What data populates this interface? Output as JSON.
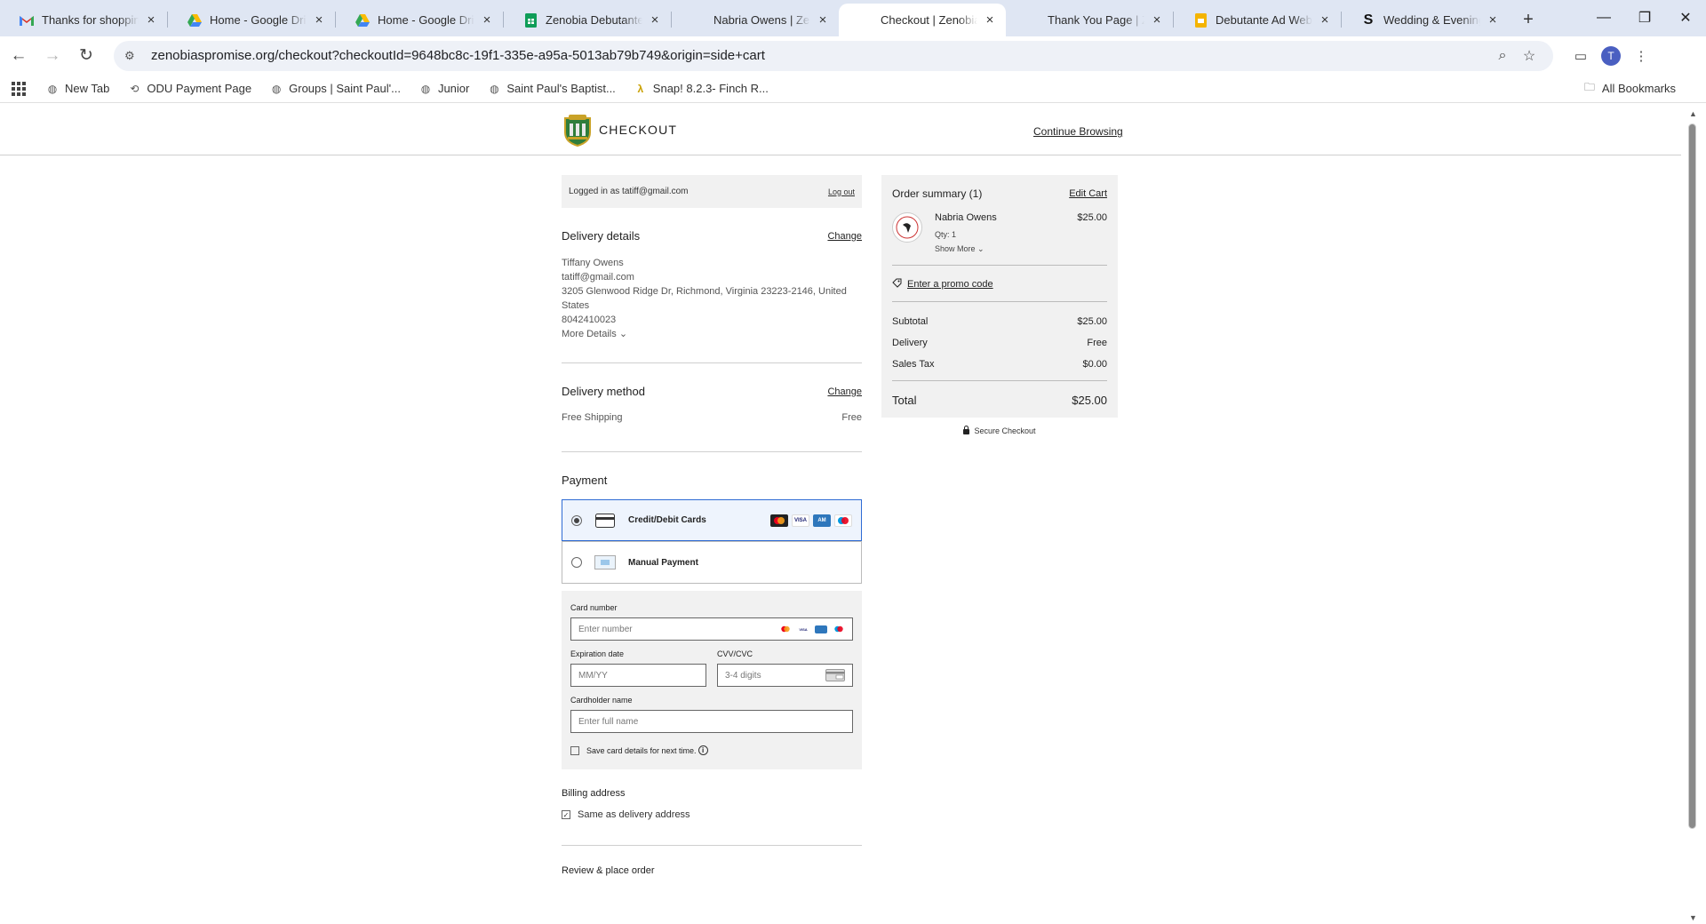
{
  "browser": {
    "tabs": [
      {
        "title": "Thanks for shopping w",
        "icon": "gmail-icon"
      },
      {
        "title": "Home - Google Drive",
        "icon": "google-drive-icon"
      },
      {
        "title": "Home - Google Drive",
        "icon": "google-drive-icon"
      },
      {
        "title": "Zenobia Debutante Ad",
        "icon": "google-sheets-icon"
      },
      {
        "title": "Nabria Owens | Zenob",
        "icon": "site-icon"
      },
      {
        "title": "Checkout | Zenobia's P",
        "icon": "site-icon"
      },
      {
        "title": "Thank You Page | Zen",
        "icon": "site-icon"
      },
      {
        "title": "Debutante Ad Websit",
        "icon": "google-slides-icon"
      },
      {
        "title": "Wedding & Evening F",
        "icon": "s-logo-icon"
      }
    ],
    "url": "zenobiaspromise.org/checkout?checkoutId=9648bc8c-19f1-335e-a95a-5013ab79b749&origin=side+cart",
    "profile_initial": "T",
    "bookmarks": [
      {
        "label": "New Tab",
        "icon": "globe-icon"
      },
      {
        "label": "ODU Payment Page",
        "icon": "link-icon"
      },
      {
        "label": "Groups | Saint Paul'...",
        "icon": "globe-icon"
      },
      {
        "label": "Junior",
        "icon": "globe-icon"
      },
      {
        "label": "Saint Paul's Baptist...",
        "icon": "globe-icon"
      },
      {
        "label": "Snap! 8.2.3- Finch R...",
        "icon": "lambda-icon"
      }
    ],
    "all_bookmarks": "All Bookmarks"
  },
  "header": {
    "logo_text": "CHECKOUT",
    "continue": "Continue Browsing"
  },
  "login": {
    "text": "Logged in as tatiff@gmail.com",
    "logout": "Log out"
  },
  "delivery_details": {
    "title": "Delivery details",
    "change": "Change",
    "name": "Tiffany Owens",
    "email": "tatiff@gmail.com",
    "address_line1": "3205 Glenwood Ridge Dr, Richmond, Virginia 23223-2146, United",
    "address_line2": "States",
    "phone": "8042410023",
    "more": "More Details"
  },
  "delivery_method": {
    "title": "Delivery method",
    "change": "Change",
    "option": "Free Shipping",
    "price": "Free"
  },
  "payment": {
    "title": "Payment",
    "options": [
      {
        "label": "Credit/Debit Cards",
        "selected": true
      },
      {
        "label": "Manual Payment",
        "selected": false
      }
    ],
    "card_number_label": "Card number",
    "card_number_placeholder": "Enter number",
    "expiration_label": "Expiration date",
    "expiration_placeholder": "MM/YY",
    "cvv_label": "CVV/CVC",
    "cvv_placeholder": "3-4 digits",
    "cardholder_label": "Cardholder name",
    "cardholder_placeholder": "Enter full name",
    "save_card": "Save card details for next time."
  },
  "billing": {
    "title": "Billing address",
    "same_as": "Same as delivery address",
    "same_checked": true
  },
  "review_title": "Review & place order",
  "summary": {
    "title": "Order summary (1)",
    "edit": "Edit Cart",
    "item_name": "Nabria Owens",
    "item_qty": "Qty: 1",
    "item_price": "$25.00",
    "show_more": "Show More",
    "promo": "Enter a promo code",
    "subtotal_label": "Subtotal",
    "subtotal": "$25.00",
    "delivery_label": "Delivery",
    "delivery": "Free",
    "tax_label": "Sales Tax",
    "tax": "$0.00",
    "total_label": "Total",
    "total": "$25.00",
    "secure": "Secure Checkout"
  },
  "colors": {
    "accent_blue": "#2e6bd4",
    "crest_green": "#2f7d3b",
    "crest_gold": "#c9a227"
  }
}
